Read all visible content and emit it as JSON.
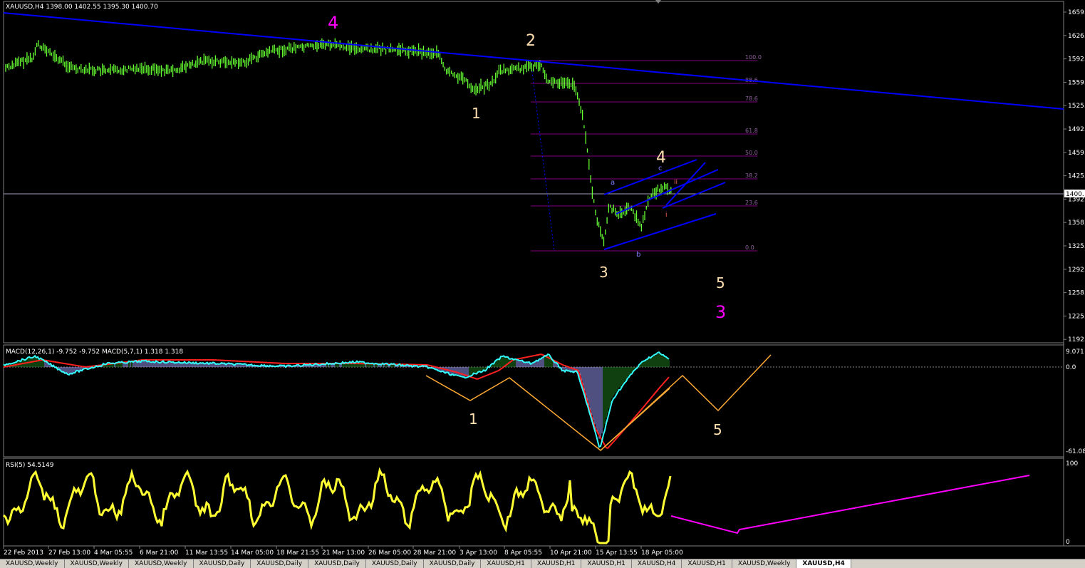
{
  "colors": {
    "bg": "#000000",
    "candle": "#66ff33",
    "trend": "#0000ff",
    "fib": "#800080",
    "macd_signal": "#ff2020",
    "macd_main": "#33ffff",
    "orange": "#ffaa33",
    "rsi": "#ffff33",
    "magenta": "#ff00ff",
    "wave": "#ffe0b0",
    "tab_bg": "#d4d0c8"
  },
  "main": {
    "header": "XAUUSD,H4  1398.00 1402.55 1395.30 1400.70",
    "price_labels": [
      "1659.",
      "1626.",
      "1592.",
      "1559.",
      "1525.",
      "1492.",
      "1459.",
      "1425.",
      "1392.",
      "1358.",
      "1325.",
      "1292.",
      "1258.",
      "1225.",
      "1192."
    ],
    "current_price": "1400.",
    "fib_levels": [
      "100.0",
      "88.6",
      "78.6",
      "61.8",
      "50.0",
      "38.2",
      "23.6",
      "0.0"
    ],
    "wave_labels": {
      "w4_mag": "4",
      "w2": "2",
      "w1": "1",
      "w4": "4",
      "w3": "3",
      "w5": "5",
      "w3_mag": "3"
    },
    "sub_labels": {
      "a": "a",
      "b": "b",
      "c": "c",
      "ii": "ii",
      "i": "i"
    }
  },
  "macd": {
    "header": "MACD(12,26,1) -9.752 -9.752  MACD(5,7,1) 1.318 1.318",
    "scale": [
      "9.071",
      "0.0",
      "-61.08"
    ],
    "wave_labels": {
      "w1": "1",
      "w5": "5"
    }
  },
  "rsi": {
    "header": "RSI(5) 54.5149",
    "scale": [
      "100",
      "0"
    ]
  },
  "time_labels": [
    "22 Feb 2013",
    "27 Feb 13:00",
    "4 Mar 05:55",
    "6 Mar 21:00",
    "11 Mar 13:55",
    "14 Mar 05:00",
    "18 Mar 21:55",
    "21 Mar 13:00",
    "26 Mar 05:00",
    "28 Mar 21:00",
    "3 Apr 13:00",
    "8 Apr 05:55",
    "10 Apr 21:00",
    "15 Apr 13:55",
    "18 Apr 05:00"
  ],
  "tabs": [
    "XAUUSD,Weekly",
    "XAUUSD,Weekly",
    "XAUUSD,Weekly",
    "XAUUSD,Daily",
    "XAUUSD,Daily",
    "XAUUSD,Daily",
    "XAUUSD,Daily",
    "XAUUSD,Daily",
    "XAUUSD,H1",
    "XAUUSD,H1",
    "XAUUSD,H1",
    "XAUUSD,H4",
    "XAUUSD,H1",
    "XAUUSD,Weekly",
    "XAUUSD,H4"
  ],
  "active_tab": 14
}
